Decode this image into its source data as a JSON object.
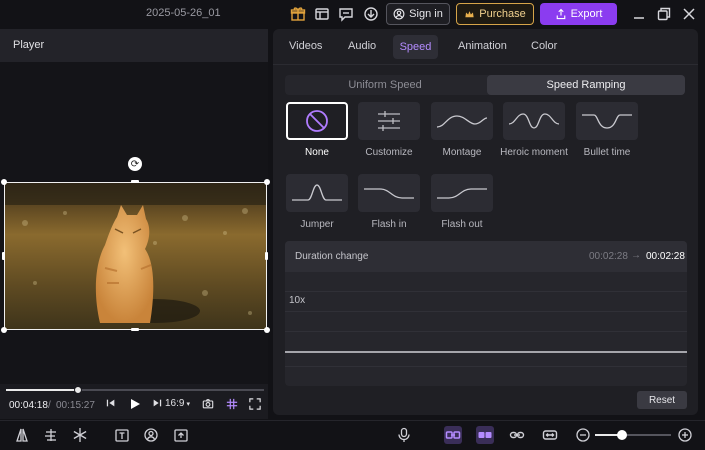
{
  "titlebar": {
    "project_title": "2025-05-26_01",
    "signin_label": "Sign in",
    "purchase_label": "Purchase",
    "export_label": "Export",
    "icons": [
      "gift-icon",
      "layout-icon",
      "feedback-icon",
      "download-icon",
      "minimize-icon",
      "restore-icon",
      "close-icon"
    ]
  },
  "player": {
    "title": "Player",
    "time_current": "00:04:18",
    "time_separator": "/",
    "time_total": "00:15:27",
    "playback_progress": 0.28,
    "aspect_ratio": "16:9",
    "thumbnail_description_icon": "cat-video-frame"
  },
  "tabs": [
    {
      "label": "Videos"
    },
    {
      "label": "Audio"
    },
    {
      "label": "Speed",
      "active": true
    },
    {
      "label": "Animation"
    },
    {
      "label": "Color"
    }
  ],
  "speed": {
    "mode_uniform": "Uniform Speed",
    "mode_ramping": "Speed Ramping",
    "active_mode": "Speed Ramping",
    "presets": [
      {
        "label": "None",
        "selected": true
      },
      {
        "label": "Customize"
      },
      {
        "label": "Montage"
      },
      {
        "label": "Heroic moment"
      },
      {
        "label": "Bullet time"
      },
      {
        "label": "Jumper"
      },
      {
        "label": "Flash in"
      },
      {
        "label": "Flash out"
      }
    ],
    "duration_label": "Duration change",
    "duration_old": "00:02:28",
    "duration_arrow": "→",
    "duration_new": "00:02:28",
    "graph_max_label": "10x",
    "reset_label": "Reset"
  },
  "toolbar": {
    "zoom_level": 0.35,
    "colors": {
      "accent": "#8b3cf0",
      "active_icon": "#b48cff"
    }
  }
}
